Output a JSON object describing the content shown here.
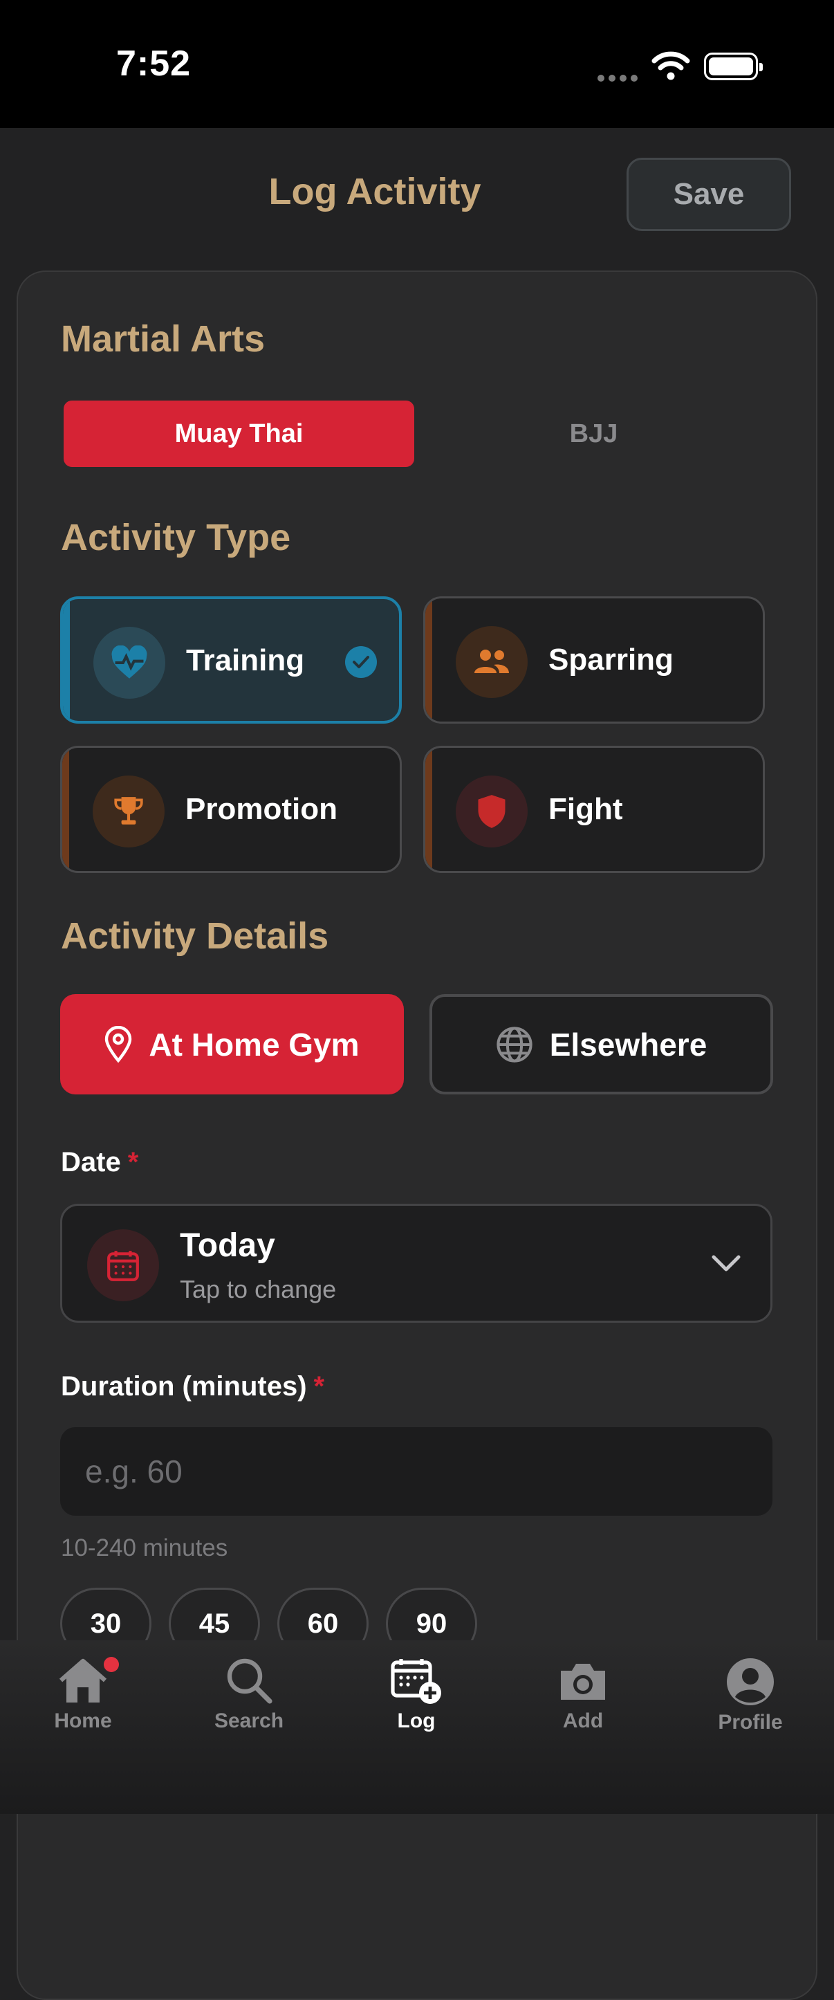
{
  "status_bar": {
    "time": "7:52"
  },
  "header": {
    "title": "Log Activity",
    "save_label": "Save"
  },
  "martial_arts": {
    "title": "Martial Arts",
    "options": [
      "Muay Thai",
      "BJJ"
    ],
    "selected": "Muay Thai"
  },
  "activity_type": {
    "title": "Activity Type",
    "options": [
      {
        "label": "Training",
        "icon": "heart-pulse-icon",
        "selected": true,
        "color": "#1c80a8"
      },
      {
        "label": "Sparring",
        "icon": "people-icon",
        "selected": false,
        "color": "#e07a2e"
      },
      {
        "label": "Promotion",
        "icon": "trophy-icon",
        "selected": false,
        "color": "#e07a2e"
      },
      {
        "label": "Fight",
        "icon": "shield-icon",
        "selected": false,
        "color": "#c62a2a"
      }
    ]
  },
  "activity_details": {
    "title": "Activity Details",
    "location_options": [
      {
        "label": "At Home Gym",
        "icon": "location-pin-icon",
        "selected": true
      },
      {
        "label": "Elsewhere",
        "icon": "globe-icon",
        "selected": false
      }
    ],
    "date": {
      "label": "Date",
      "required_mark": "*",
      "value": "Today",
      "hint": "Tap to change"
    },
    "duration": {
      "label": "Duration (minutes)",
      "required_mark": "*",
      "placeholder": "e.g. 60",
      "value": "",
      "hint": "10-240 minutes",
      "presets": [
        "30",
        "45",
        "60",
        "90"
      ]
    }
  },
  "tab_bar": {
    "items": [
      {
        "label": "Home",
        "icon": "home-icon",
        "active": false,
        "badge": true
      },
      {
        "label": "Search",
        "icon": "search-icon",
        "active": false
      },
      {
        "label": "Log",
        "icon": "calendar-add-icon",
        "active": true
      },
      {
        "label": "Add",
        "icon": "camera-icon",
        "active": false
      },
      {
        "label": "Profile",
        "icon": "profile-icon",
        "active": false
      }
    ]
  },
  "colors": {
    "accent": "#d62335",
    "heading": "#c8a97c",
    "selected_blue": "#1c80a8",
    "background": "#222223"
  }
}
